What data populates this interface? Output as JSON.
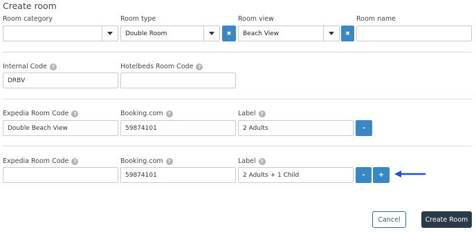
{
  "title": "Create room",
  "row1": {
    "room_category": {
      "label": "Room category",
      "value": ""
    },
    "room_type": {
      "label": "Room type",
      "value": "Double Room"
    },
    "room_view": {
      "label": "Room view",
      "value": "Beach View"
    },
    "room_name": {
      "label": "Room name",
      "value": ""
    },
    "clear_glyph": "✖"
  },
  "codes": {
    "internal_label": "Internal Code",
    "internal_value": "DRBV",
    "hotelbeds_label": "Hotelbeds Room Code",
    "hotelbeds_value": ""
  },
  "mappings": [
    {
      "expedia_label": "Expedia Room Code",
      "expedia_value": "Double Beach View",
      "booking_label": "Booking.com",
      "booking_value": "59874101",
      "label_label": "Label",
      "label_value": "2 Adults",
      "remove": "-",
      "add": ""
    },
    {
      "expedia_label": "Expedia Room Code",
      "expedia_value": "",
      "booking_label": "Booking.com",
      "booking_value": "59874101",
      "label_label": "Label",
      "label_value": "2 Adults + 1 Child",
      "remove": "-",
      "add": "+"
    }
  ],
  "help_glyph": "?",
  "arrow_color": "#1a4fd6",
  "footer": {
    "cancel": "Cancel",
    "create": "Create Room"
  }
}
